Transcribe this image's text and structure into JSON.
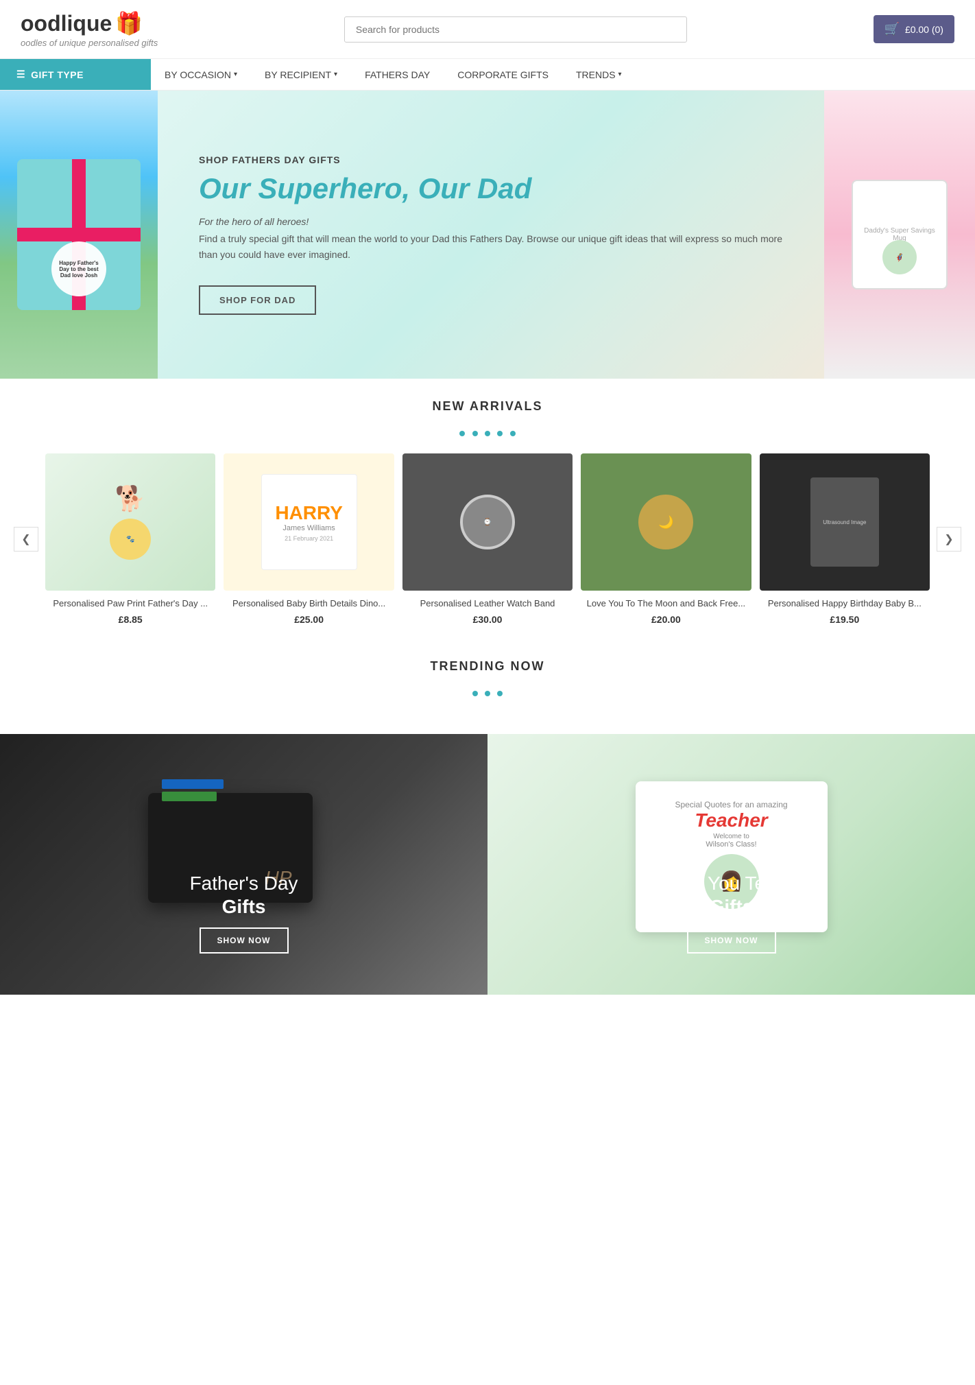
{
  "header": {
    "logo_text": "oodlique",
    "logo_tagline": "oodles of unique personalised gifts",
    "search_placeholder": "Search for products",
    "cart_label": "£0.00 (0)"
  },
  "nav": {
    "gift_type": "GIFT TYPE",
    "items": [
      {
        "label": "BY OCCASION",
        "has_dropdown": true
      },
      {
        "label": "BY RECIPIENT",
        "has_dropdown": true
      },
      {
        "label": "FATHERS DAY",
        "has_dropdown": false
      },
      {
        "label": "CORPORATE GIFTS",
        "has_dropdown": false
      },
      {
        "label": "TRENDS",
        "has_dropdown": true
      }
    ]
  },
  "hero": {
    "sub_title": "SHOP FATHERS DAY GIFTS",
    "title": "Our Superhero, Our Dad",
    "tagline": "For the hero of all heroes!",
    "description": "Find a truly special gift that will mean the world to your Dad this Fathers Day. Browse our unique gift ideas that will express so much more than you could have ever imagined.",
    "cta_label": "SHOP FOR DAD",
    "gift_tag_text": "Happy Father's Day to the best Dad love Josh"
  },
  "new_arrivals": {
    "section_title": "NEW ARRIVALS",
    "prev_label": "‹",
    "next_label": "›",
    "products": [
      {
        "name": "Personalised Paw Print Father's Day ...",
        "price": "£8.85",
        "visual": "paw"
      },
      {
        "name": "Personalised Baby Birth Details Dino...",
        "price": "£25.00",
        "visual": "dino"
      },
      {
        "name": "Personalised Leather Watch Band",
        "price": "£30.00",
        "visual": "watch"
      },
      {
        "name": "Love You To The Moon and Back Free...",
        "price": "£20.00",
        "visual": "moon"
      },
      {
        "name": "Personalised Happy Birthday Baby B...",
        "price": "£19.50",
        "visual": "ultrasound"
      }
    ]
  },
  "trending": {
    "section_title": "TRENDING NOW"
  },
  "category_banners": [
    {
      "id": "fathers-day",
      "title_line1": "Father's Day",
      "title_line2": "Gifts",
      "cta_label": "SHOW NOW",
      "type": "dark"
    },
    {
      "id": "teacher",
      "title_line1": "Thank You Teacher",
      "title_line2": "Gifts",
      "cta_label": "SHOW NOW",
      "type": "light"
    }
  ],
  "icons": {
    "menu": "☰",
    "gift": "🎁",
    "cart": "🛒",
    "chevron_down": "▾",
    "prev": "❮",
    "next": "❯"
  }
}
